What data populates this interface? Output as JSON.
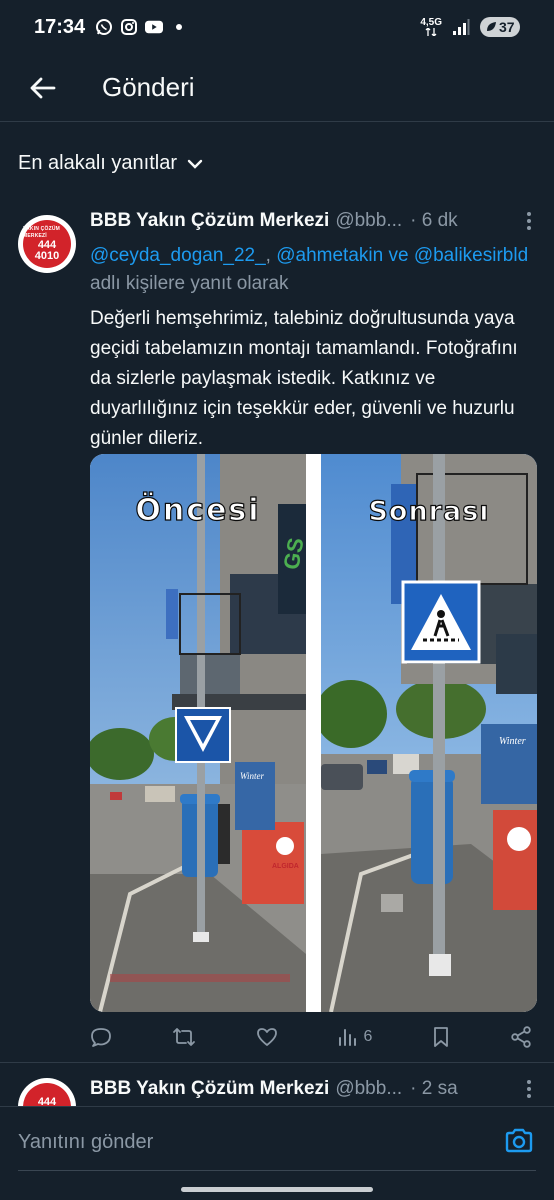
{
  "status_bar": {
    "time": "17:34",
    "network": "4,5G",
    "battery": "37"
  },
  "header": {
    "title": "Gönderi"
  },
  "sort": {
    "label": "En alakalı yanıtlar"
  },
  "tweet": {
    "author_name": "BBB Yakın Çözüm Merkezi",
    "author_handle": "@bbb...",
    "time": "· 6 dk",
    "avatar_text_top": "YAKIN ÇÖZÜM MERKEZİ",
    "avatar_number_1": "444",
    "avatar_number_2": "4010",
    "reply_mention_1": "@ceyda_dogan_22_",
    "reply_sep_1": ", ",
    "reply_mention_2": "@ahmetakin",
    "reply_and": " ve ",
    "reply_mention_3": "@balikesirbld",
    "reply_suffix": " adlı kişilere yanıt olarak",
    "text": "Değerli hemşehrimiz, talebiniz doğrultusunda yaya geçidi tabelamızın montajı tamamlandı. Fotoğrafını da sizlerle paylaşmak istedik. Katkınız ve duyarlılığınız için teşekkür eder, güvenli ve huzurlu günler dileriz.",
    "image_label_before": "Öncesi",
    "image_label_after": "Sonrası",
    "image_shop_sign": "GS",
    "image_bin_brand": "ALGIDA",
    "image_cart_brand": "Winter",
    "views": "6"
  },
  "tweet2": {
    "author_name": "BBB Yakın Çözüm Merkezi",
    "author_handle": "@bbb...",
    "time": "· 2 sa",
    "avatar_number_1": "444"
  },
  "reply_bar": {
    "placeholder": "Yanıtını gönder"
  },
  "colors": {
    "background": "#15202b",
    "accent": "#1d9bf0",
    "muted": "#8b98a5",
    "avatar_red": "#d2232a"
  }
}
